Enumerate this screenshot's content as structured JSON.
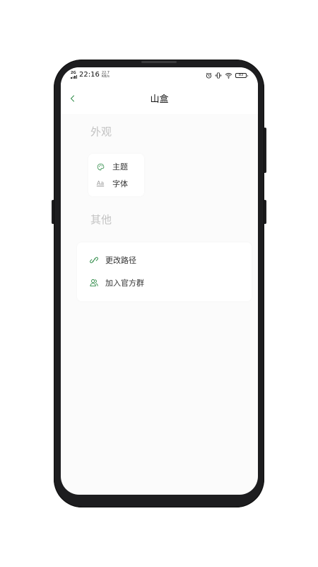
{
  "status_bar": {
    "network": "2G",
    "time": "22:16",
    "speed_value": "22.7",
    "speed_unit": "KB/s",
    "battery": "83",
    "icons": [
      "alarm-icon",
      "vibrate-icon",
      "wifi-icon",
      "battery-icon"
    ]
  },
  "nav": {
    "back_icon": "chevron-left-icon",
    "title": "山盒"
  },
  "sections": {
    "appearance": {
      "label": "外观",
      "items": [
        {
          "icon": "palette-icon",
          "label": "主题"
        },
        {
          "icon": "font-icon",
          "icon_text": "Aa",
          "label": "字体"
        }
      ]
    },
    "other": {
      "label": "其他",
      "items": [
        {
          "icon": "link-icon",
          "label": "更改路径"
        },
        {
          "icon": "group-icon",
          "label": "加入官方群"
        }
      ]
    }
  },
  "colors": {
    "accent": "#2e8b47",
    "section_label": "#c2c2c2",
    "screen_bg": "#fbfbfb",
    "card_bg": "#ffffff",
    "frame": "#1d1d1f"
  }
}
